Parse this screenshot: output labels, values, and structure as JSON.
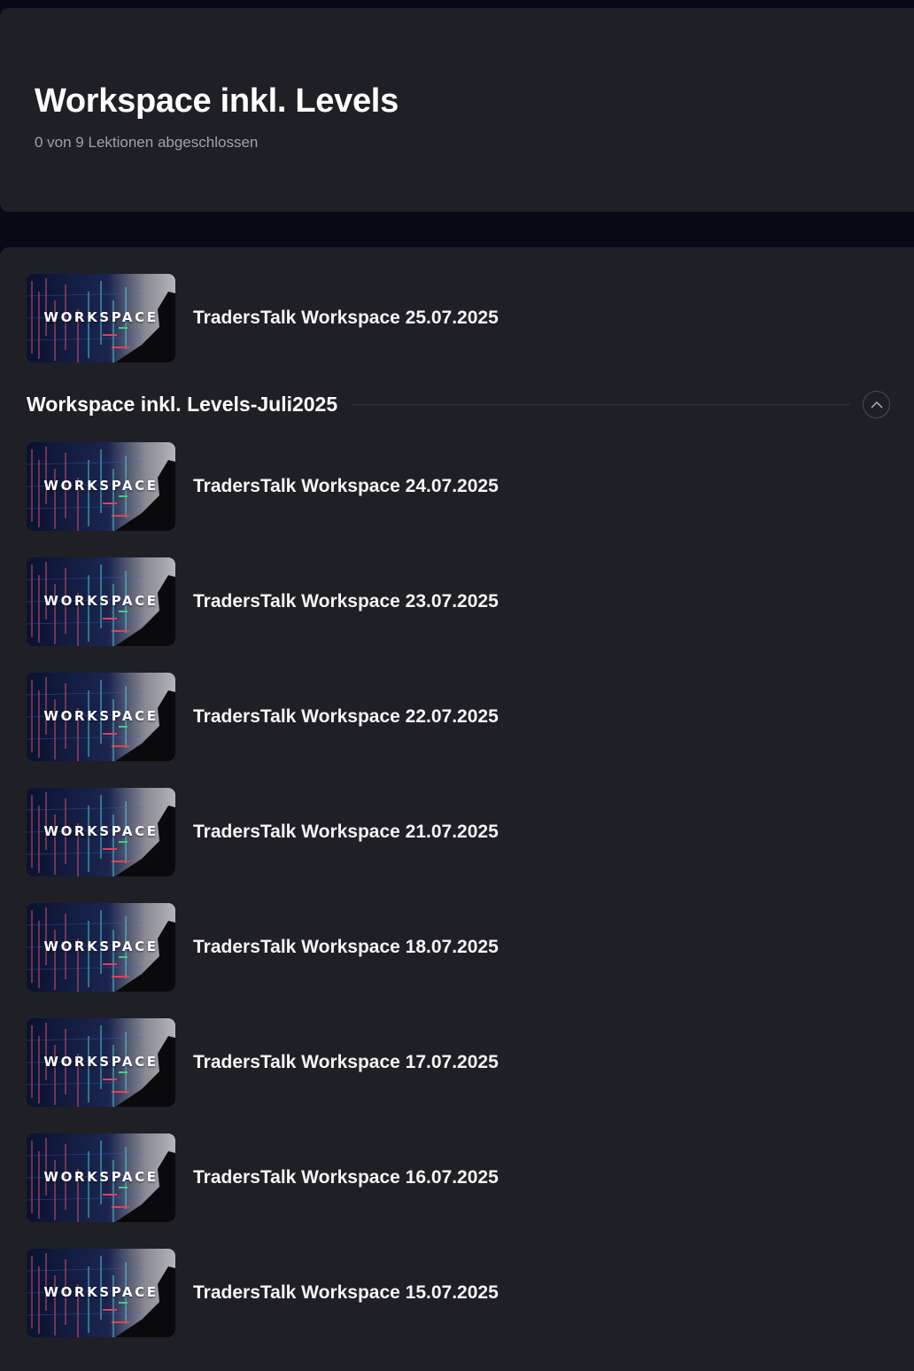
{
  "course": {
    "title": "Workspace inkl. Levels",
    "progress": "0 von 9 Lektionen abgeschlossen"
  },
  "thumbnail_label": "WORKSPACE",
  "top_lessons": [
    {
      "title": "TradersTalk Workspace 25.07.2025"
    }
  ],
  "section": {
    "title": "Workspace inkl. Levels-Juli2025",
    "toggle_icon": "chevron-up-icon",
    "lessons": [
      {
        "title": "TradersTalk Workspace 24.07.2025"
      },
      {
        "title": "TradersTalk Workspace 23.07.2025"
      },
      {
        "title": "TradersTalk Workspace 22.07.2025"
      },
      {
        "title": "TradersTalk Workspace 21.07.2025"
      },
      {
        "title": "TradersTalk Workspace 18.07.2025"
      },
      {
        "title": "TradersTalk Workspace 17.07.2025"
      },
      {
        "title": "TradersTalk Workspace 16.07.2025"
      },
      {
        "title": "TradersTalk Workspace 15.07.2025"
      }
    ]
  },
  "colors": {
    "page_background": "#070a15",
    "card_background": "#1f1f26",
    "text_primary": "#ffffff",
    "text_secondary": "#a0a0ab"
  }
}
